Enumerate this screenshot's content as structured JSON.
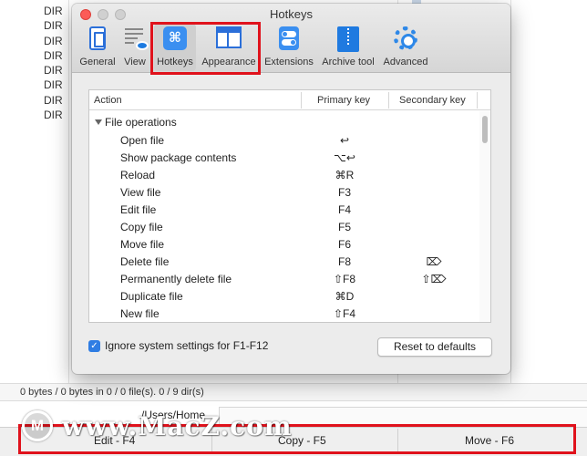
{
  "background": {
    "dir_items": [
      "DIR",
      "DIR",
      "DIR",
      "DIR",
      "DIR",
      "DIR",
      "DIR",
      "DIR"
    ],
    "status_text": "0 bytes / 0 bytes in 0 / 0 file(s). 0 / 9 dir(s)",
    "path": "/Users/Home",
    "fkeys": [
      "Edit - F4",
      "Copy - F5",
      "Move - F6"
    ],
    "watermark": "www.MacZ.com",
    "watermark_logo": "M"
  },
  "dialog": {
    "title": "Hotkeys",
    "tabs": [
      {
        "label": "General",
        "icon": "general-icon"
      },
      {
        "label": "View",
        "icon": "view-icon"
      },
      {
        "label": "Hotkeys",
        "icon": "hotkeys-icon",
        "active": true
      },
      {
        "label": "Appearance",
        "icon": "appearance-icon"
      },
      {
        "label": "Extensions",
        "icon": "extensions-icon"
      },
      {
        "label": "Archive tool",
        "icon": "archive-tool-icon"
      },
      {
        "label": "Advanced",
        "icon": "advanced-icon"
      }
    ],
    "hotkeys_glyph": "⌘",
    "table": {
      "columns": [
        "Action",
        "Primary key",
        "Secondary key"
      ],
      "group": "File operations",
      "rows": [
        {
          "action": "Open file",
          "primary": "↩",
          "secondary": ""
        },
        {
          "action": "Show package contents",
          "primary": "⌥↩",
          "secondary": ""
        },
        {
          "action": "Reload",
          "primary": "⌘R",
          "secondary": ""
        },
        {
          "action": "View file",
          "primary": "F3",
          "secondary": ""
        },
        {
          "action": "Edit file",
          "primary": "F4",
          "secondary": ""
        },
        {
          "action": "Copy file",
          "primary": "F5",
          "secondary": ""
        },
        {
          "action": "Move file",
          "primary": "F6",
          "secondary": ""
        },
        {
          "action": "Delete file",
          "primary": "F8",
          "secondary": "⌦"
        },
        {
          "action": "Permanently delete file",
          "primary": "⇧F8",
          "secondary": "⇧⌦"
        },
        {
          "action": "Duplicate file",
          "primary": "⌘D",
          "secondary": ""
        },
        {
          "action": "New file",
          "primary": "⇧F4",
          "secondary": ""
        }
      ]
    },
    "ignore_system_label": "Ignore system settings for F1-F12",
    "ignore_system_checked": true,
    "reset_label": "Reset to defaults",
    "check_mark": "✓"
  },
  "colors": {
    "highlight": "#e0121c",
    "accent": "#2f7de3",
    "close_button": "#fc5b57"
  }
}
